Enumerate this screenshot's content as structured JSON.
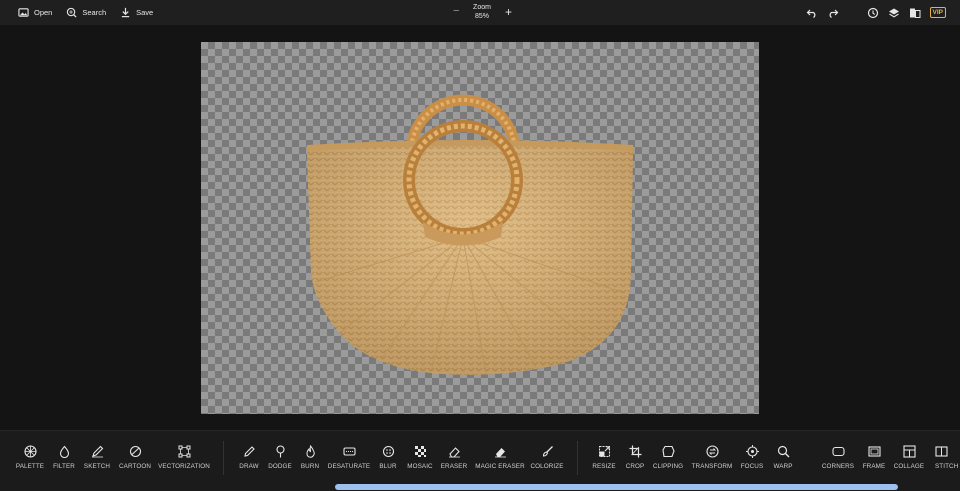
{
  "topbar": {
    "open_label": "Open",
    "search_label": "Search",
    "save_label": "Save",
    "zoom_title": "Zoom",
    "zoom_value": "85%",
    "vip_label": "VIP",
    "icons": [
      "undo-icon",
      "redo-icon",
      "history-icon",
      "layers-icon",
      "compare-icon",
      "vip-icon"
    ]
  },
  "canvas": {
    "image_subject": "woven-straw-handbag",
    "checker_colors": [
      "#9b9b9b",
      "#7a7a7a"
    ]
  },
  "tools": {
    "group1": [
      {
        "label": "PALETTE",
        "icon": "palette-icon"
      },
      {
        "label": "FILTER",
        "icon": "drop-icon"
      },
      {
        "label": "SKETCH",
        "icon": "pencil-icon"
      },
      {
        "label": "CARTOON",
        "icon": "cartoon-icon"
      },
      {
        "label": "VECTORIZATION",
        "icon": "vector-icon"
      }
    ],
    "group2": [
      {
        "label": "DRAW",
        "icon": "pen-icon"
      },
      {
        "label": "DODGE",
        "icon": "dodge-icon"
      },
      {
        "label": "BURN",
        "icon": "flame-icon"
      },
      {
        "label": "DESATURATE",
        "icon": "desaturate-icon"
      },
      {
        "label": "BLUR",
        "icon": "blur-icon"
      },
      {
        "label": "MOSAIC",
        "icon": "mosaic-icon"
      },
      {
        "label": "ERASER",
        "icon": "eraser-icon"
      },
      {
        "label": "MAGIC ERASER",
        "icon": "magic-eraser-icon"
      },
      {
        "label": "COLORIZE",
        "icon": "brush-icon"
      }
    ],
    "group3": [
      {
        "label": "RESIZE",
        "icon": "resize-icon"
      },
      {
        "label": "CROP",
        "icon": "crop-icon"
      },
      {
        "label": "CLIPPING",
        "icon": "clipping-icon"
      },
      {
        "label": "TRANSFORM",
        "icon": "transform-icon"
      },
      {
        "label": "FOCUS",
        "icon": "focus-icon"
      },
      {
        "label": "WARP",
        "icon": "warp-icon"
      }
    ],
    "group4": [
      {
        "label": "CORNERS",
        "icon": "corners-icon"
      },
      {
        "label": "FRAME",
        "icon": "frame-icon"
      },
      {
        "label": "COLLAGE",
        "icon": "collage-icon"
      },
      {
        "label": "STITCH",
        "icon": "stitch-icon"
      }
    ]
  },
  "colors": {
    "background": "#141414",
    "bar": "#1f1f1f",
    "accent_vip": "#e8b04c",
    "scrollbar": "#9ec0ee"
  }
}
